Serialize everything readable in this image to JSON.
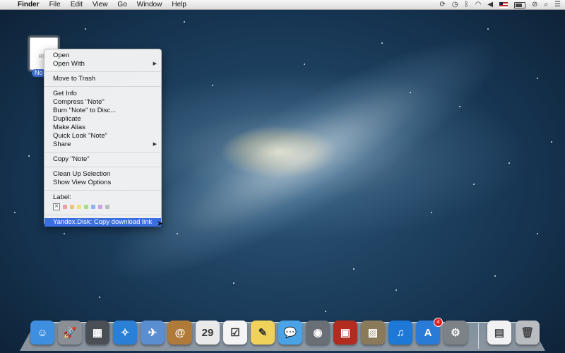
{
  "menubar": {
    "apple_glyph": "",
    "app_name": "Finder",
    "items": [
      "File",
      "Edit",
      "View",
      "Go",
      "Window",
      "Help"
    ],
    "status_icons": [
      "sync-icon",
      "time-machine-icon",
      "bluetooth-icon",
      "wifi-icon",
      "volume-icon",
      "flag-icon",
      "battery-icon",
      "notification-block-icon",
      "search-icon",
      "list-icon"
    ]
  },
  "desktop": {
    "file": {
      "name": "No",
      "type_label": "RTF",
      "icon": "rtf-document-icon"
    }
  },
  "context_menu": {
    "open": "Open",
    "open_with": "Open With",
    "move_to_trash": "Move to Trash",
    "get_info": "Get Info",
    "compress": "Compress \"Note\"",
    "burn": "Burn \"Note\" to Disc...",
    "duplicate": "Duplicate",
    "make_alias": "Make Alias",
    "quick_look": "Quick Look \"Note\"",
    "share": "Share",
    "copy": "Copy \"Note\"",
    "clean_up": "Clean Up Selection",
    "show_view_options": "Show View Options",
    "label": "Label:",
    "label_none_glyph": "✕",
    "label_colors": [
      "#f0a0a0",
      "#f3c07c",
      "#efe07a",
      "#a6dd8a",
      "#8fb4ee",
      "#c9a4e0",
      "#bdbdbd"
    ],
    "yandex": "Yandex.Disk: Copy download link",
    "submenu_arrow": "▶",
    "highlight_color": "#3a6fe0"
  },
  "dock": {
    "items": [
      {
        "name": "finder-icon",
        "glyph": "☺",
        "color": "#3f8fe0"
      },
      {
        "name": "launchpad-icon",
        "glyph": "🚀",
        "color": "#8a8f96"
      },
      {
        "name": "mission-control-icon",
        "glyph": "▦",
        "color": "#4a4f56"
      },
      {
        "name": "safari-icon",
        "glyph": "✧",
        "color": "#2a7fd6"
      },
      {
        "name": "mail-icon",
        "glyph": "✈",
        "color": "#5b8ed0"
      },
      {
        "name": "contacts-icon",
        "glyph": "@",
        "color": "#b07a3a"
      },
      {
        "name": "calendar-icon",
        "glyph": "29",
        "color": "#e9e9e9"
      },
      {
        "name": "reminders-icon",
        "glyph": "☑",
        "color": "#f4f4f4"
      },
      {
        "name": "notes-icon",
        "glyph": "✎",
        "color": "#f0d15a"
      },
      {
        "name": "messages-icon",
        "glyph": "💬",
        "color": "#4aa3e6"
      },
      {
        "name": "facetime-icon",
        "glyph": "◉",
        "color": "#6a6f76"
      },
      {
        "name": "photo-booth-icon",
        "glyph": "▣",
        "color": "#b12b1f"
      },
      {
        "name": "iphoto-icon",
        "glyph": "▨",
        "color": "#8b7a5a"
      },
      {
        "name": "itunes-icon",
        "glyph": "♫",
        "color": "#1e78d6"
      },
      {
        "name": "app-store-icon",
        "glyph": "A",
        "color": "#2a7ad8",
        "badge": "4"
      },
      {
        "name": "system-preferences-icon",
        "glyph": "⚙",
        "color": "#7d8287"
      }
    ],
    "right_items": [
      {
        "name": "document-stack-icon",
        "glyph": "▤",
        "color": "#f2f2f2"
      },
      {
        "name": "trash-icon",
        "glyph": "🗑",
        "color": "#b9bdc1"
      }
    ]
  }
}
